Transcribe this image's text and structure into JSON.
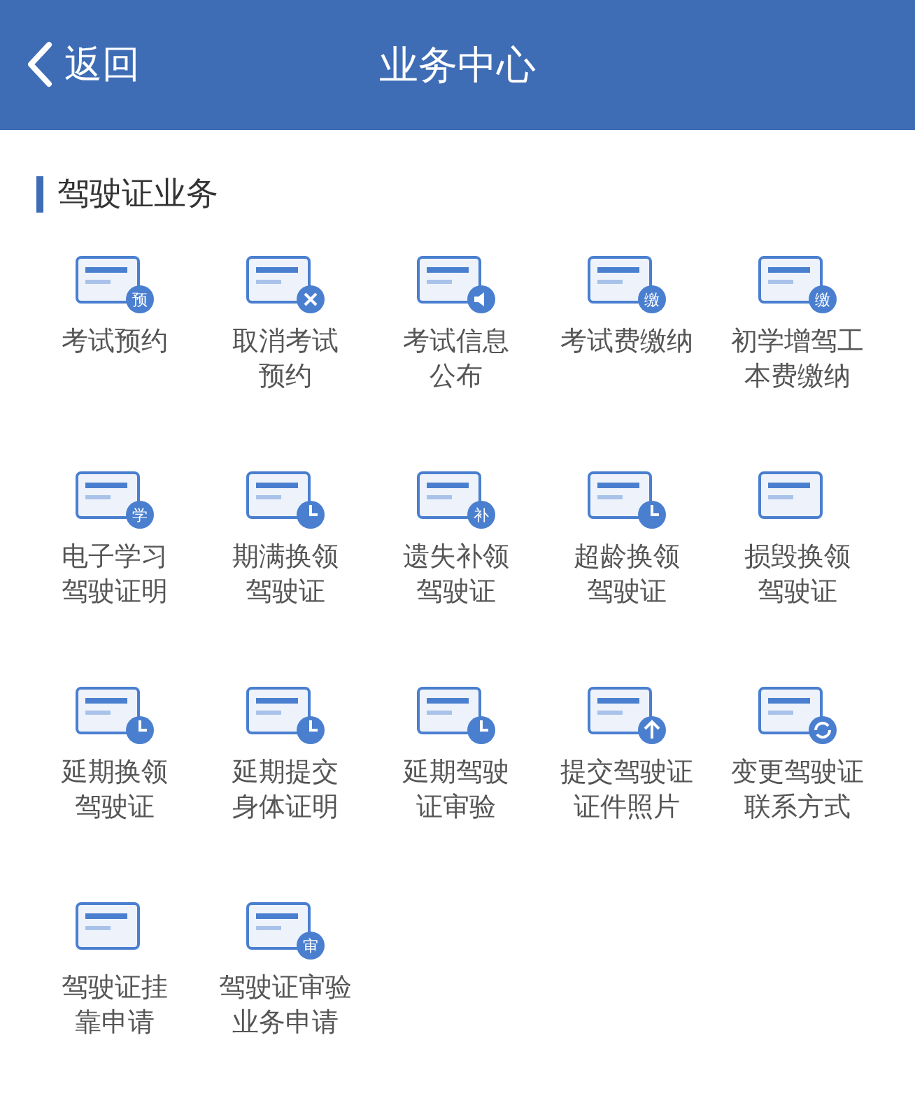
{
  "header": {
    "back": "返回",
    "title": "业务中心"
  },
  "section": {
    "title": "驾驶证业务",
    "items": [
      {
        "label": "考试预约",
        "kind": "text",
        "badge": "预"
      },
      {
        "label": "取消考试预约",
        "kind": "close"
      },
      {
        "label": "考试信息公布",
        "kind": "sound"
      },
      {
        "label": "考试费缴纳",
        "kind": "text",
        "badge": "缴"
      },
      {
        "label": "初学增驾工本费缴纳",
        "kind": "text",
        "badge": "缴"
      },
      {
        "label": "电子学习驾驶证明",
        "kind": "text",
        "badge": "学"
      },
      {
        "label": "期满换领驾驶证",
        "kind": "clock"
      },
      {
        "label": "遗失补领驾驶证",
        "kind": "text",
        "badge": "补"
      },
      {
        "label": "超龄换领驾驶证",
        "kind": "clock"
      },
      {
        "label": "损毁换领驾驶证",
        "kind": "plain"
      },
      {
        "label": "延期换领驾驶证",
        "kind": "clock"
      },
      {
        "label": "延期提交身体证明",
        "kind": "clock"
      },
      {
        "label": "延期驾驶证审验",
        "kind": "clock"
      },
      {
        "label": "提交驾驶证证件照片",
        "kind": "up"
      },
      {
        "label": "变更驾驶证联系方式",
        "kind": "refresh"
      },
      {
        "label": "驾驶证挂靠申请",
        "kind": "plain"
      },
      {
        "label": "驾驶证审验业务申请",
        "kind": "text",
        "badge": "审"
      }
    ]
  }
}
